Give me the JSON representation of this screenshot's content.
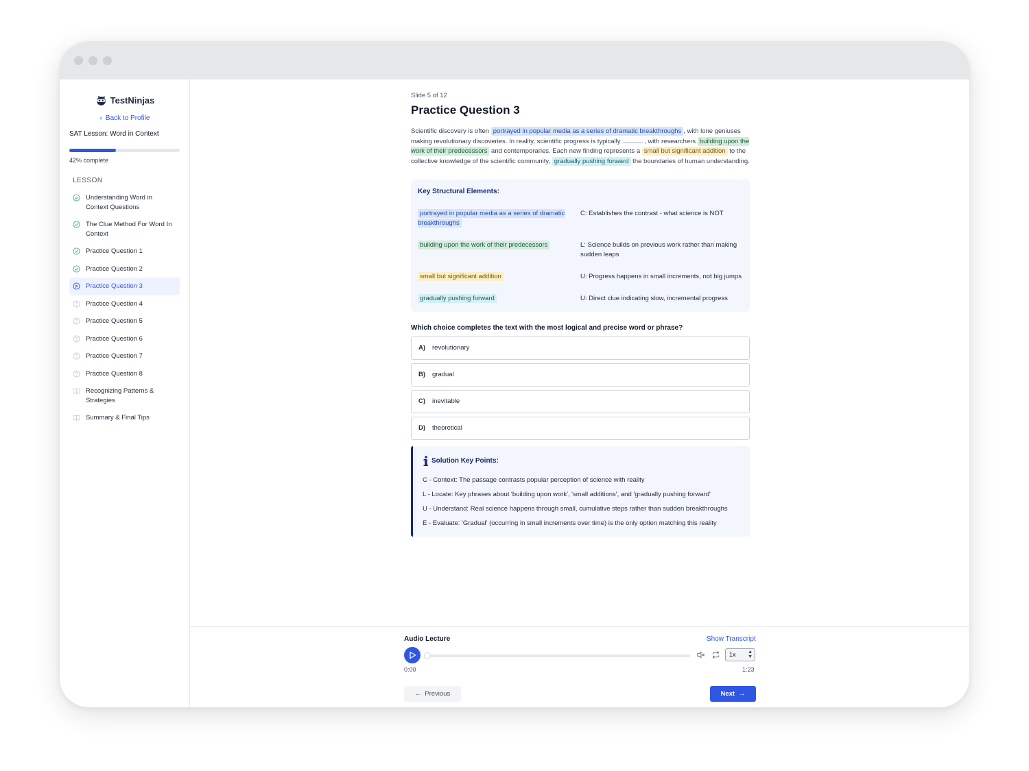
{
  "brand": {
    "name": "TestNinjas"
  },
  "sidebar": {
    "back_label": "Back to Profile",
    "lesson_title": "SAT Lesson: Word in Context",
    "progress_percent": 42,
    "progress_text": "42% complete",
    "section_label": "LESSON",
    "items": [
      {
        "label": "Understanding Word in Context Questions",
        "status": "done"
      },
      {
        "label": "The Clue Method For Word In Context",
        "status": "done"
      },
      {
        "label": "Practice Question 1",
        "status": "done"
      },
      {
        "label": "Practice Question 2",
        "status": "done"
      },
      {
        "label": "Practice Question 3",
        "status": "current"
      },
      {
        "label": "Practice Question 4",
        "status": "todo"
      },
      {
        "label": "Practice Question 5",
        "status": "todo"
      },
      {
        "label": "Practice Question 6",
        "status": "todo"
      },
      {
        "label": "Practice Question 7",
        "status": "todo"
      },
      {
        "label": "Practice Question 8",
        "status": "todo"
      },
      {
        "label": "Recognizing Patterns & Strategies",
        "status": "reading"
      },
      {
        "label": "Summary & Final Tips",
        "status": "reading"
      }
    ]
  },
  "slide": {
    "counter": "Slide 5 of 12",
    "title": "Practice Question 3"
  },
  "passage": {
    "t1": "Scientific discovery is often ",
    "h1": "portrayed in popular media as a series of dramatic breakthroughs",
    "t2": ", with lone geniuses making revolutionary discoveries. In reality, scientific progress is typically ",
    "t3": ", with researchers ",
    "h2": "building upon the work of their predecessors",
    "t4": " and contemporaries. Each new finding represents a ",
    "h3": "small but significant addition",
    "t5": " to the collective knowledge of the scientific community, ",
    "h4": "gradually pushing forward",
    "t6": " the boundaries of human understanding."
  },
  "key_elements": {
    "title": "Key Structural Elements:",
    "rows": [
      {
        "phrase": "portrayed in popular media as a series of dramatic breakthroughs",
        "color": "blue",
        "explanation": "C: Establishes the contrast - what science is NOT"
      },
      {
        "phrase": "building upon the work of their predecessors",
        "color": "green",
        "explanation": "L: Science builds on previous work rather than making sudden leaps"
      },
      {
        "phrase": "small but significant addition",
        "color": "yellow",
        "explanation": "U: Progress happens in small increments, not big jumps"
      },
      {
        "phrase": "gradually pushing forward",
        "color": "cyan",
        "explanation": "U: Direct clue indicating slow, incremental progress"
      }
    ]
  },
  "question": {
    "prompt": "Which choice completes the text with the most logical and precise word or phrase?",
    "options": [
      {
        "letter": "A)",
        "text": "revolutionary"
      },
      {
        "letter": "B)",
        "text": "gradual"
      },
      {
        "letter": "C)",
        "text": "inevitable"
      },
      {
        "letter": "D)",
        "text": "theoretical"
      }
    ]
  },
  "solution": {
    "title": "Solution Key Points:",
    "lines": [
      "C - Context: The passage contrasts popular perception of science with reality",
      "L - Locate: Key phrases about 'building upon work', 'small additions', and 'gradually pushing forward'",
      "U - Understand: Real science happens through small, cumulative steps rather than sudden breakthroughs",
      "E - Evaluate: 'Gradual' (occurring in small increments over time) is the only option matching this reality"
    ]
  },
  "audio": {
    "title": "Audio Lecture",
    "show_transcript": "Show Transcript",
    "current_time": "0:00",
    "duration": "1:23",
    "speed": "1x",
    "progress_fraction": 0
  },
  "nav": {
    "previous": "Previous",
    "next": "Next"
  },
  "colors": {
    "accent": "#2f57e3",
    "done": "#3fb37a",
    "highlight_blue": "#d6e4fb",
    "highlight_green": "#d3ecdd",
    "highlight_yellow": "#fcefc7",
    "highlight_cyan": "#d4f0f5"
  }
}
